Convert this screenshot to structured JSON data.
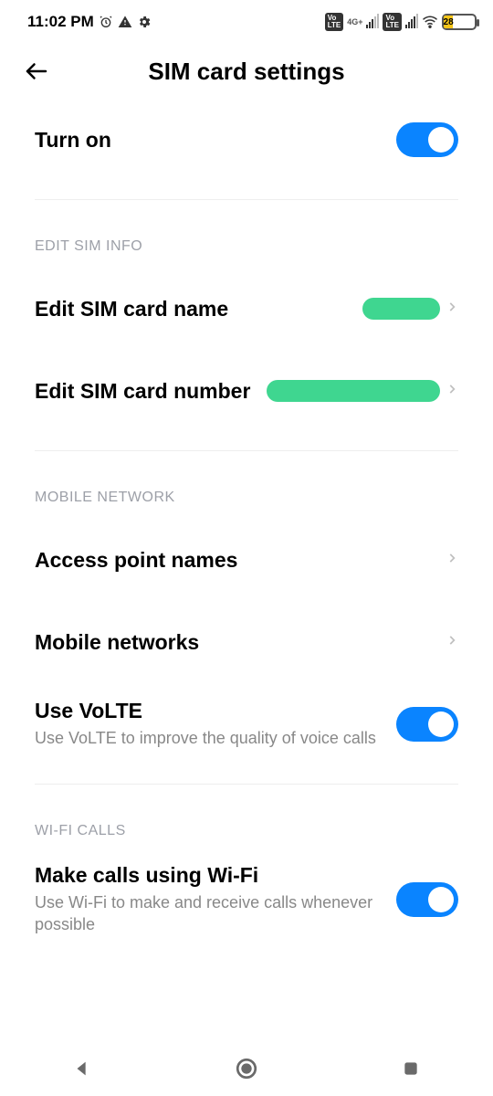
{
  "status": {
    "time": "11:02 PM",
    "battery_pct": "28",
    "net_label": "4G+"
  },
  "header": {
    "title": "SIM card settings"
  },
  "turn_on": {
    "label": "Turn on"
  },
  "section_edit_sim": {
    "header": "EDIT SIM INFO"
  },
  "edit_name": {
    "label": "Edit SIM card name"
  },
  "edit_number": {
    "label": "Edit SIM card number"
  },
  "section_mobile_net": {
    "header": "MOBILE NETWORK"
  },
  "apn": {
    "label": "Access point names"
  },
  "mobile_networks": {
    "label": "Mobile networks"
  },
  "volte": {
    "label": "Use VoLTE",
    "sub": "Use VoLTE to improve the quality of voice calls"
  },
  "section_wifi_calls": {
    "header": "WI-FI CALLS"
  },
  "wifi_calls": {
    "label": "Make calls using Wi-Fi",
    "sub": "Use Wi-Fi to make and receive calls whenever possible"
  }
}
